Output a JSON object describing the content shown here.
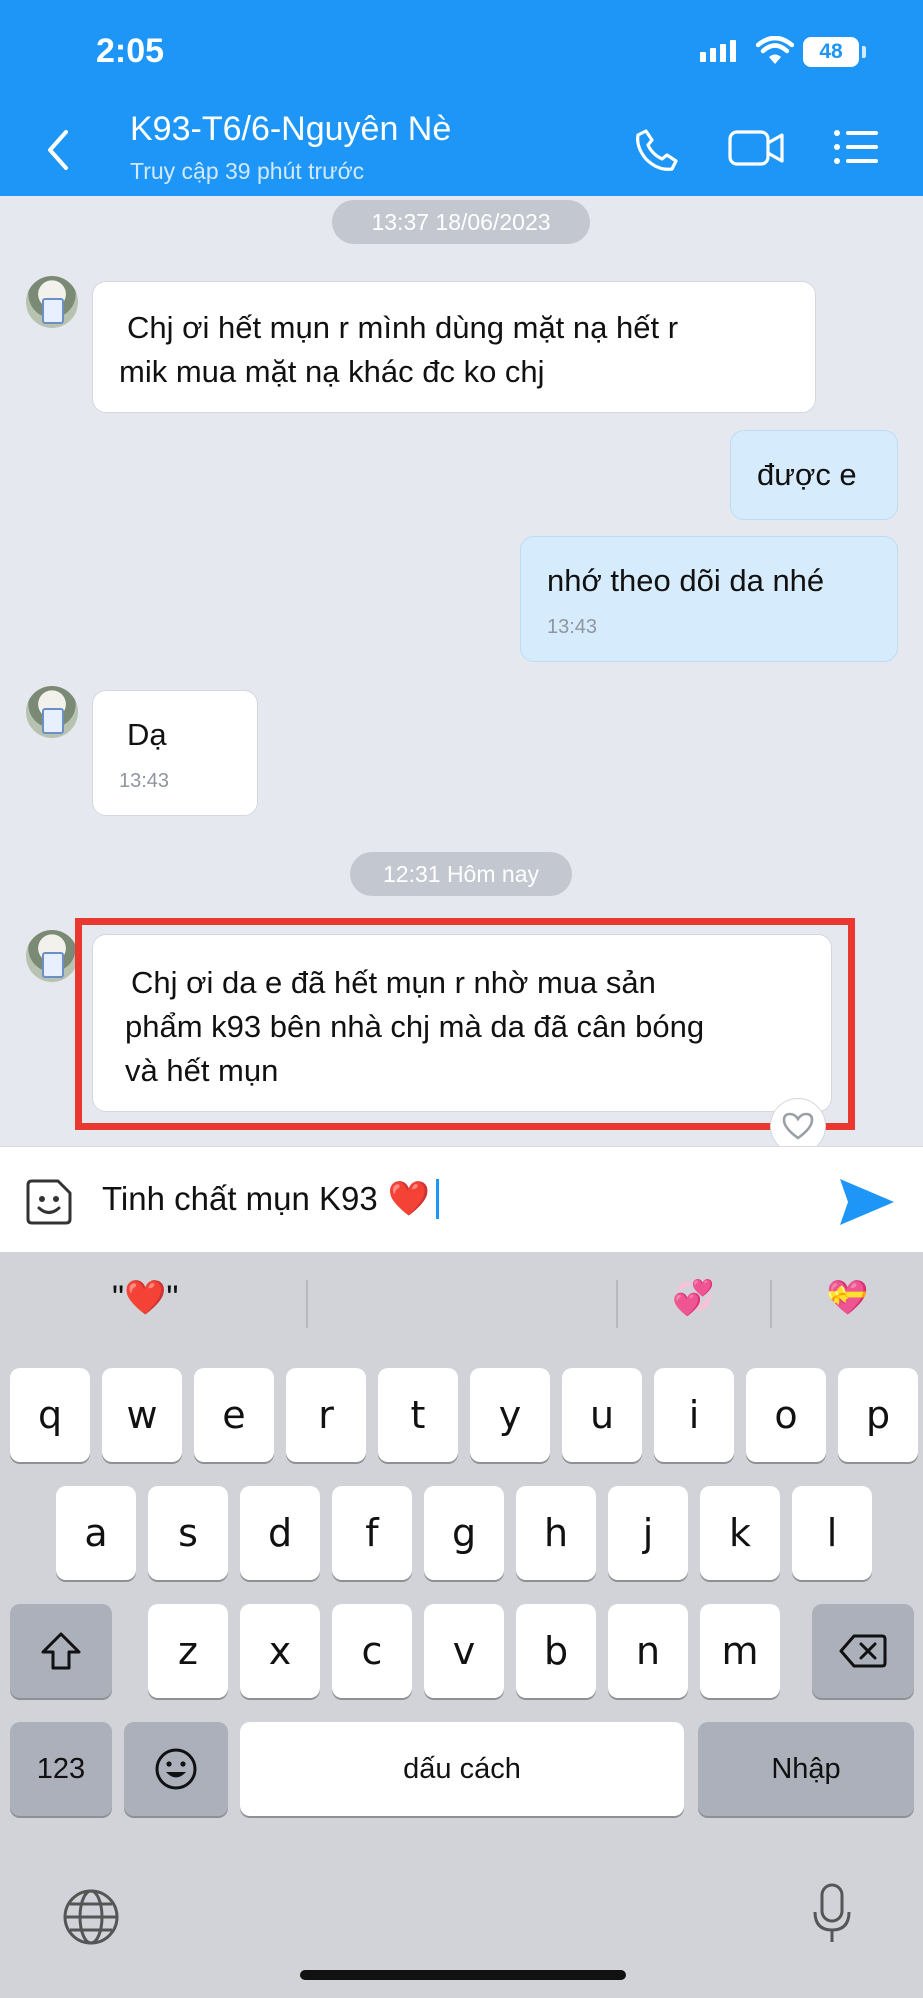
{
  "status_bar": {
    "time": "2:05",
    "battery": "48"
  },
  "header": {
    "title": "K93-T6/6-Nguyên Nè",
    "subtitle": "Truy cập 39 phút trước"
  },
  "messages": [
    {
      "kind": "date",
      "text": "13:37 18/06/2023"
    },
    {
      "kind": "in",
      "lines": [
        "Chj ơi  hết mụn r mình dùng mặt nạ hết r",
        "mik mua mặt nạ khác đc ko chj"
      ]
    },
    {
      "kind": "out",
      "lines": [
        "được e"
      ]
    },
    {
      "kind": "out",
      "lines": [
        "nhớ theo dõi da nhé"
      ],
      "time": "13:43"
    },
    {
      "kind": "in",
      "lines": [
        "Dạ"
      ],
      "time": "13:43"
    },
    {
      "kind": "date",
      "text": "12:31 Hôm nay"
    },
    {
      "kind": "in",
      "lines": [
        "Chj ơi da e đã hết mụn r nhờ  mua sản",
        "phẩm k93 bên nhà chj mà da đã cân bóng",
        "và hết mụn"
      ]
    }
  ],
  "input": {
    "text": "Tinh chất mụn K93",
    "emoji": "❤️"
  },
  "keyboard": {
    "suggestions": [
      "\"❤️\"",
      "",
      "💞",
      "💝"
    ],
    "row1": [
      "q",
      "w",
      "e",
      "r",
      "t",
      "y",
      "u",
      "i",
      "o",
      "p"
    ],
    "row2": [
      "a",
      "s",
      "d",
      "f",
      "g",
      "h",
      "j",
      "k",
      "l"
    ],
    "row3": [
      "z",
      "x",
      "c",
      "v",
      "b",
      "n",
      "m"
    ],
    "numbers_key": "123",
    "space_key": "dấu cách",
    "return_key": "Nhập"
  },
  "colors": {
    "header": "#1d96f7",
    "highlight": "#e8382f",
    "send": "#1d96f7"
  }
}
